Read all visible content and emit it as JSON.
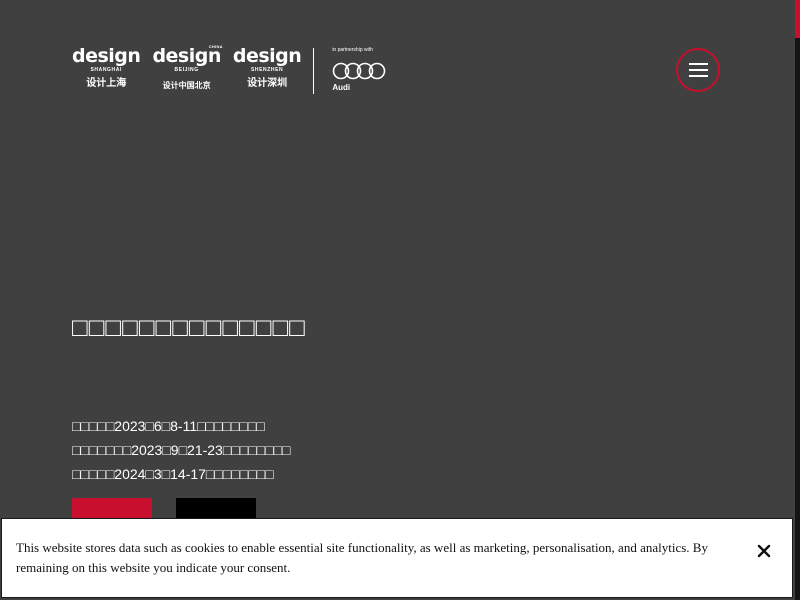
{
  "header": {
    "logos": [
      {
        "word": "design",
        "city": "SHANGHAI",
        "cn": "设计上海",
        "badge": ""
      },
      {
        "word": "design",
        "city": "BEIJING",
        "cn": "设计中国北京",
        "badge": "CHINA"
      },
      {
        "word": "design",
        "city": "SHENZHEN",
        "cn": "设计深圳",
        "badge": ""
      }
    ],
    "partner_tag": "in partnership with",
    "partner_name": "Audi",
    "menu_icon": "hamburger-icon"
  },
  "hero": {
    "headline": "□□□□□□□□□□□□□□",
    "dates": [
      "□□□□□2023□6□8-11□□□□□□□□",
      "□□□□□□□2023□9□21-23□□□□□□□□",
      "□□□□□2024□3□14-17□□□□□□□□"
    ],
    "cta_primary": "",
    "cta_secondary": ""
  },
  "cookie_banner": {
    "text": "This website stores data such as cookies to enable essential site functionality, as well as marketing, personalisation, and analytics. By remaining on this website you indicate your consent.",
    "close_icon": "close-icon"
  },
  "colors": {
    "background": "#404040",
    "accent": "#c8102e",
    "banner": "#ffffff",
    "text": "#ffffff"
  }
}
